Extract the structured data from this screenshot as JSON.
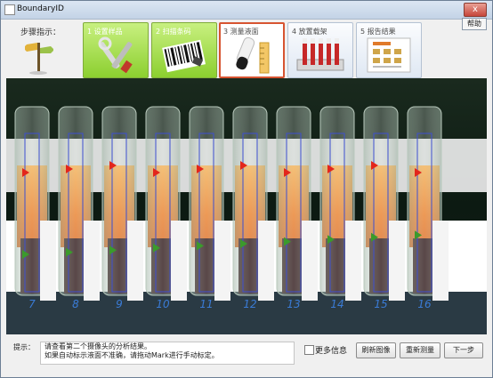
{
  "window": {
    "title": "BoundaryID",
    "close": "x",
    "help": "帮助"
  },
  "steps_label": "步骤指示：",
  "steps": [
    {
      "label": "1  设置样品",
      "state": "done"
    },
    {
      "label": "2  扫描条码",
      "state": "done"
    },
    {
      "label": "3  测量液面",
      "state": "active"
    },
    {
      "label": "4  放置载架",
      "state": "pending"
    },
    {
      "label": "5  报告结果",
      "state": "pending"
    }
  ],
  "tube_numbers": [
    "7",
    "8",
    "9",
    "10",
    "11",
    "12",
    "13",
    "14",
    "15",
    "16"
  ],
  "hint": {
    "label": "提示：",
    "line1": "请查看第二个摄像头的分析结果。",
    "line2": "如果自动标示液面不准确，请拖动Mark进行手动标定。"
  },
  "more_info": "更多信息",
  "buttons": {
    "refresh": "刷新图像",
    "remeasure": "重新测量",
    "next": "下一步"
  },
  "colors": {
    "tube_orange": "#f08a2c",
    "marker_red": "#e3261b",
    "marker_green": "#3b9a2c",
    "step_done_green": "#8ccf2f",
    "step_active_border": "#d75431"
  }
}
